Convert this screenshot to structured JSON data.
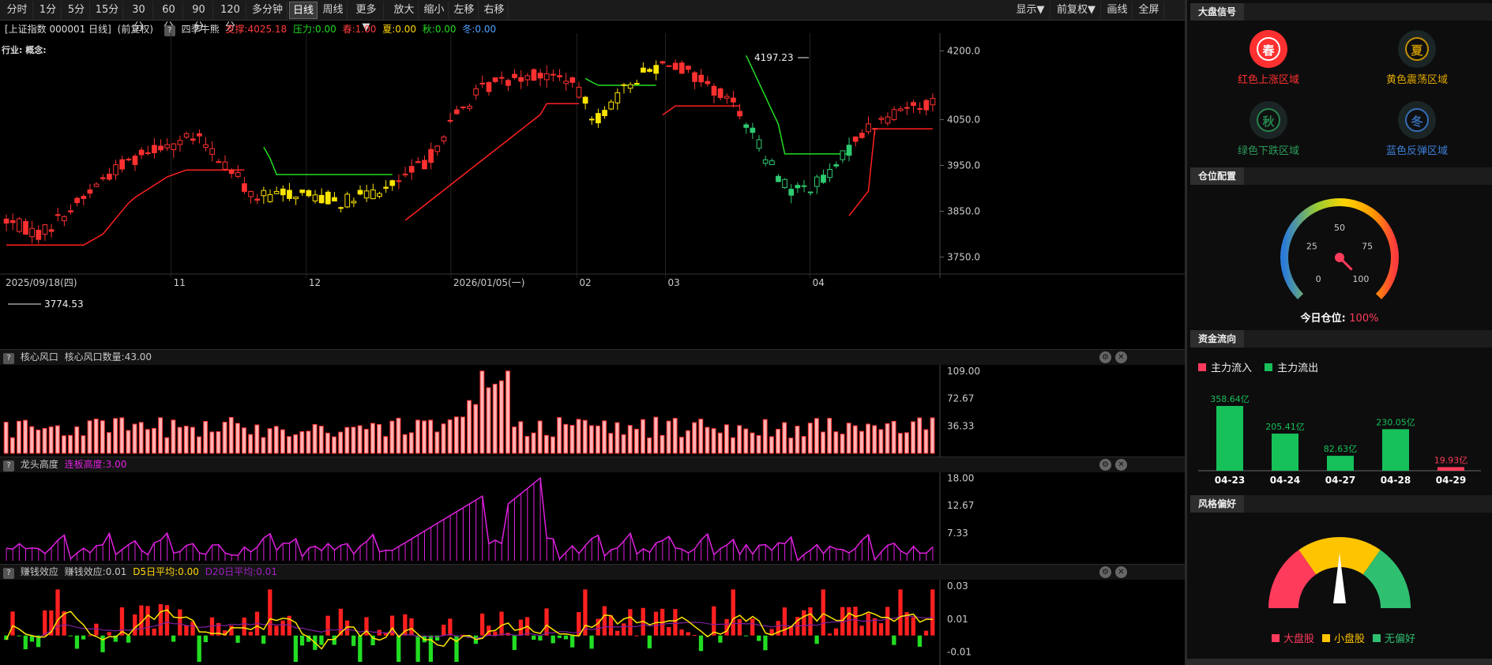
{
  "toolbar": {
    "periods": [
      "分时",
      "1分",
      "5分",
      "15分",
      "30分",
      "60分",
      "90分",
      "120分",
      "多分钟",
      "日线",
      "周线",
      "更多▼",
      "放大",
      "缩小",
      "左移",
      "右移"
    ],
    "active": "日线",
    "right": [
      "显示▼",
      "前复权▼",
      "画线",
      "全屏"
    ]
  },
  "info": {
    "title": "[上证指数 000001 日线]",
    "adjust": "(前复权)",
    "indicator": "四季牛熊",
    "support_label": "支撑:4025.18",
    "pressure_label": "压力:0.00",
    "spring_label": "春:1.00",
    "summer_label": "夏:0.00",
    "autumn_label": "秋:0.00",
    "winter_label": "冬:0.00",
    "industry": "行业: 概念:",
    "colors": {
      "support": "#ff3b3b",
      "pressure": "#22dd22",
      "spring": "#ff3b3b",
      "summer": "#ffd700",
      "autumn": "#22dd22",
      "winter": "#4fa3ff"
    }
  },
  "main_chart": {
    "y_ticks": [
      "4200.0",
      "4050.0",
      "3950.0",
      "3850.0",
      "3750.0"
    ],
    "y_values": [
      4200,
      4050,
      3950,
      3850,
      3750
    ],
    "ylim": [
      3730,
      4225
    ],
    "high_label": "4197.23",
    "low_label": "3774.53",
    "x_labels": [
      "2025/09/18(四)",
      "11",
      "12",
      "2026/01/05(一)",
      "02",
      "03",
      "04"
    ]
  },
  "panel1": {
    "title": "核心风口",
    "value_label": "核心风口数量:43.00",
    "y_ticks": [
      "109.00",
      "72.67",
      "36.33"
    ],
    "y_values": [
      109,
      72.67,
      36.33
    ],
    "ylim": [
      0,
      113
    ]
  },
  "panel2": {
    "title": "龙头高度",
    "value_label": "连板高度:3.00",
    "y_ticks": [
      "18.00",
      "12.67",
      "7.33"
    ],
    "y_values": [
      18,
      12.67,
      7.33
    ],
    "ylim": [
      2,
      18.5
    ]
  },
  "panel3": {
    "title": "赚钱效应",
    "value_label": "赚钱效应:0.01",
    "d5_label": "D5日平均:0.00",
    "d20_label": "D20日平均:0.01",
    "y_ticks": [
      "0.03",
      "0.01",
      "-0.01"
    ],
    "y_values": [
      0.03,
      0.01,
      -0.01
    ],
    "ylim": [
      -0.016,
      0.032
    ]
  },
  "right": {
    "sec1": "大盘信号",
    "seasons": [
      {
        "char": "春",
        "label": "红色上涨区域",
        "color": "#ff3030",
        "active": true
      },
      {
        "char": "夏",
        "label": "黄色震荡区域",
        "color": "#e0a800",
        "active": false
      },
      {
        "char": "秋",
        "label": "绿色下跌区域",
        "color": "#2a9a5a",
        "active": false
      },
      {
        "char": "冬",
        "label": "蓝色反弹区域",
        "color": "#3d7fd6",
        "active": false
      }
    ],
    "sec2": "仓位配置",
    "gauge_ticks": [
      "0",
      "25",
      "50",
      "75",
      "100"
    ],
    "position_label": "今日仓位:",
    "position_value": "100%",
    "position_level": 100,
    "sec3": "资金流向",
    "legend_in": "主力流入",
    "legend_out": "主力流出",
    "flow": [
      {
        "date": "04-23",
        "value": 358.64,
        "label": "358.64亿",
        "dir": "out"
      },
      {
        "date": "04-24",
        "value": 205.41,
        "label": "205.41亿",
        "dir": "out"
      },
      {
        "date": "04-27",
        "value": 82.63,
        "label": "82.63亿",
        "dir": "out"
      },
      {
        "date": "04-28",
        "value": 230.05,
        "label": "230.05亿",
        "dir": "out"
      },
      {
        "date": "04-29",
        "value": 19.93,
        "label": "19.93亿",
        "dir": "in"
      }
    ],
    "sec4": "风格偏好",
    "style_legend": [
      "大盘股",
      "小盘股",
      "无偏好"
    ],
    "style_colors": [
      "#ff3b5c",
      "#ffc400",
      "#2fbf71"
    ]
  }
}
